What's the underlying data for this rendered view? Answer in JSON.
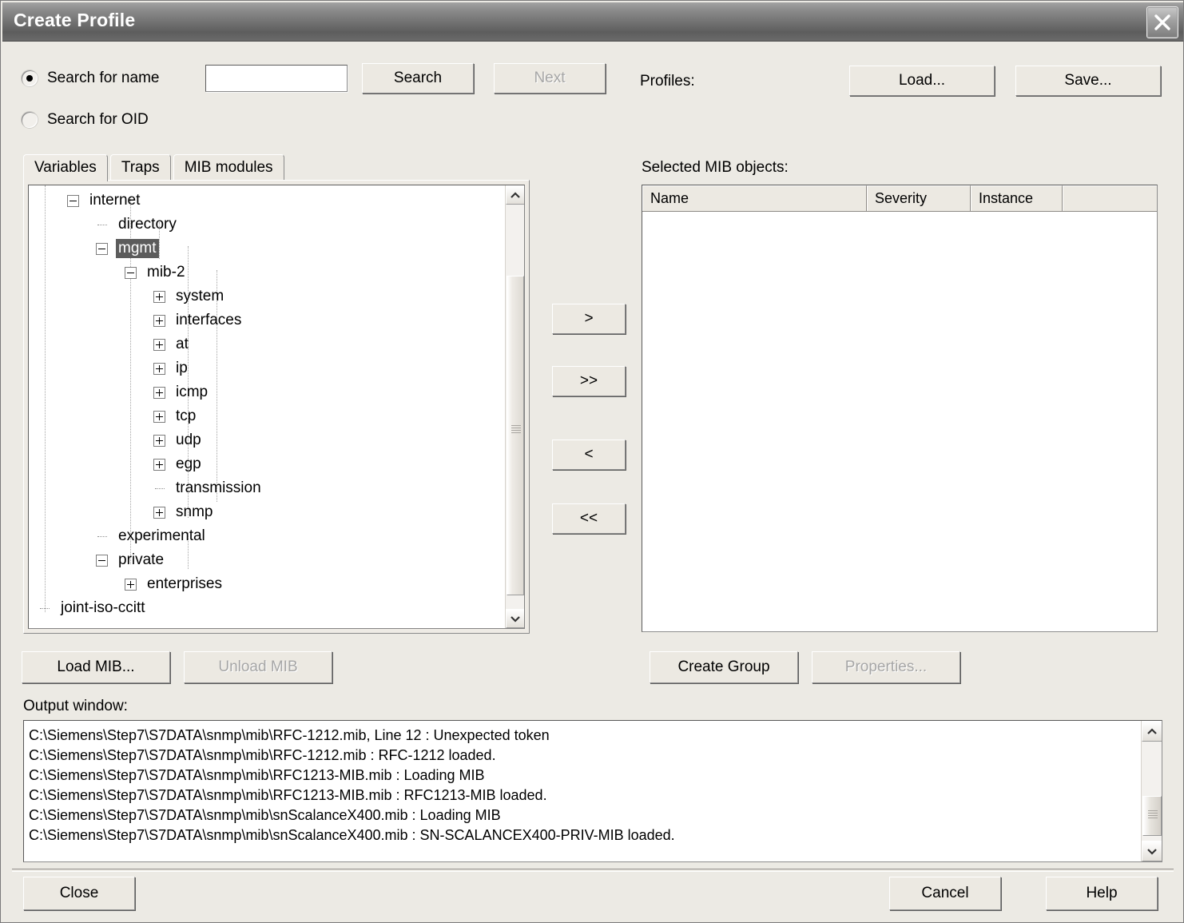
{
  "window": {
    "title": "Create Profile",
    "close_icon": "close-icon"
  },
  "search": {
    "radio_name_label": "Search for name",
    "radio_oid_label": "Search for OID",
    "selected": "name",
    "input_value": "",
    "input_placeholder": "",
    "search_button": "Search",
    "next_button": "Next",
    "next_disabled": true
  },
  "profiles": {
    "label": "Profiles:",
    "load_button": "Load...",
    "save_button": "Save..."
  },
  "tabs": [
    {
      "label": "Variables",
      "active": true
    },
    {
      "label": "Traps",
      "active": false
    },
    {
      "label": "MIB modules",
      "active": false
    }
  ],
  "tree": {
    "nodes": [
      {
        "label": "internet",
        "depth": 1,
        "state": "minus",
        "selected": false
      },
      {
        "label": "directory",
        "depth": 2,
        "state": "leaf",
        "selected": false
      },
      {
        "label": "mgmt",
        "depth": 2,
        "state": "minus",
        "selected": true
      },
      {
        "label": "mib-2",
        "depth": 3,
        "state": "minus",
        "selected": false
      },
      {
        "label": "system",
        "depth": 4,
        "state": "plus",
        "selected": false
      },
      {
        "label": "interfaces",
        "depth": 4,
        "state": "plus",
        "selected": false
      },
      {
        "label": "at",
        "depth": 4,
        "state": "plus",
        "selected": false
      },
      {
        "label": "ip",
        "depth": 4,
        "state": "plus",
        "selected": false
      },
      {
        "label": "icmp",
        "depth": 4,
        "state": "plus",
        "selected": false
      },
      {
        "label": "tcp",
        "depth": 4,
        "state": "plus",
        "selected": false
      },
      {
        "label": "udp",
        "depth": 4,
        "state": "plus",
        "selected": false
      },
      {
        "label": "egp",
        "depth": 4,
        "state": "plus",
        "selected": false
      },
      {
        "label": "transmission",
        "depth": 4,
        "state": "leaf",
        "selected": false
      },
      {
        "label": "snmp",
        "depth": 4,
        "state": "plus",
        "selected": false
      },
      {
        "label": "experimental",
        "depth": 2,
        "state": "leaf",
        "selected": false
      },
      {
        "label": "private",
        "depth": 2,
        "state": "minus",
        "selected": false
      },
      {
        "label": "enterprises",
        "depth": 3,
        "state": "plus",
        "selected": false
      },
      {
        "label": "joint-iso-ccitt",
        "depth": 0,
        "state": "leaf",
        "selected": false
      }
    ]
  },
  "transfer": {
    "move_one_right": ">",
    "move_all_right": ">>",
    "move_one_left": "<",
    "move_all_left": "<<"
  },
  "selected_objects": {
    "label": "Selected MIB objects:",
    "columns": [
      "Name",
      "Severity",
      "Instance",
      ""
    ],
    "rows": []
  },
  "mib_actions": {
    "load_mib": "Load MIB...",
    "unload_mib": "Unload MIB",
    "unload_disabled": true,
    "create_group": "Create Group",
    "properties": "Properties...",
    "properties_disabled": true
  },
  "output": {
    "label": "Output window:",
    "lines": [
      "C:\\Siemens\\Step7\\S7DATA\\snmp\\mib\\RFC-1212.mib, Line 12 : Unexpected token",
      "C:\\Siemens\\Step7\\S7DATA\\snmp\\mib\\RFC-1212.mib : RFC-1212 loaded.",
      "C:\\Siemens\\Step7\\S7DATA\\snmp\\mib\\RFC1213-MIB.mib : Loading MIB",
      "C:\\Siemens\\Step7\\S7DATA\\snmp\\mib\\RFC1213-MIB.mib : RFC1213-MIB loaded.",
      "C:\\Siemens\\Step7\\S7DATA\\snmp\\mib\\snScalanceX400.mib : Loading MIB",
      "C:\\Siemens\\Step7\\S7DATA\\snmp\\mib\\snScalanceX400.mib : SN-SCALANCEX400-PRIV-MIB loaded."
    ]
  },
  "footer": {
    "close_button": "Close",
    "cancel_button": "Cancel",
    "help_button": "Help"
  },
  "colors": {
    "dialog_face": "#eceae4",
    "selection": "#5c5c5c",
    "title_bar_dark": "#5d5d5d",
    "title_bar_light": "#a3a3a3"
  }
}
